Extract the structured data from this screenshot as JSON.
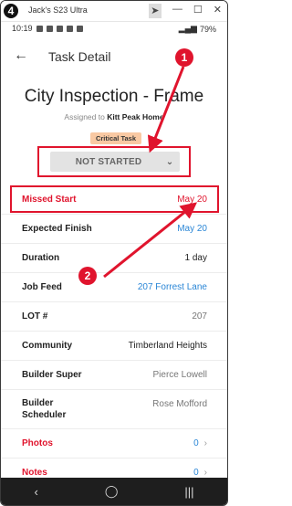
{
  "window": {
    "step_number": "4",
    "title": "Jack's S23 Ultra",
    "icons": [
      "cursor-icon",
      "minimize-icon",
      "maximize-icon",
      "close-icon"
    ],
    "minimize_glyph": "—",
    "maximize_glyph": "☐",
    "close_glyph": "✕"
  },
  "statusbar": {
    "time": "10:19",
    "battery": "79%"
  },
  "appbar": {
    "back_glyph": "←",
    "title": "Task Detail"
  },
  "task": {
    "title": "City Inspection - Frame",
    "assigned_prefix": "Assigned to",
    "assigned_to": "Kitt Peak Home",
    "badge": "Critical Task",
    "status": "NOT STARTED",
    "status_chevron": "⌄"
  },
  "details": [
    {
      "key": "Missed Start",
      "value": "May 20"
    },
    {
      "key": "Expected Finish",
      "value": "May 20"
    },
    {
      "key": "Duration",
      "value": "1 day"
    },
    {
      "key": "Job Feed",
      "value": "207 Forrest Lane"
    },
    {
      "key": "LOT #",
      "value": "207"
    },
    {
      "key": "Community",
      "value": "Timberland Heights"
    },
    {
      "key": "Builder Super",
      "value": "Pierce Lowell"
    },
    {
      "key": "Builder Scheduler",
      "value": "Rose Mofford"
    },
    {
      "key": "Photos",
      "value": "0"
    },
    {
      "key": "Notes",
      "value": "0"
    }
  ],
  "annotations": {
    "one": "1",
    "two": "2"
  },
  "navbar": {
    "back": "‹",
    "home": "◯",
    "recents": "|||"
  },
  "colors": {
    "accent_red": "#e0142d",
    "link_blue": "#2a86d6",
    "badge_bg": "#f9c9a3"
  }
}
